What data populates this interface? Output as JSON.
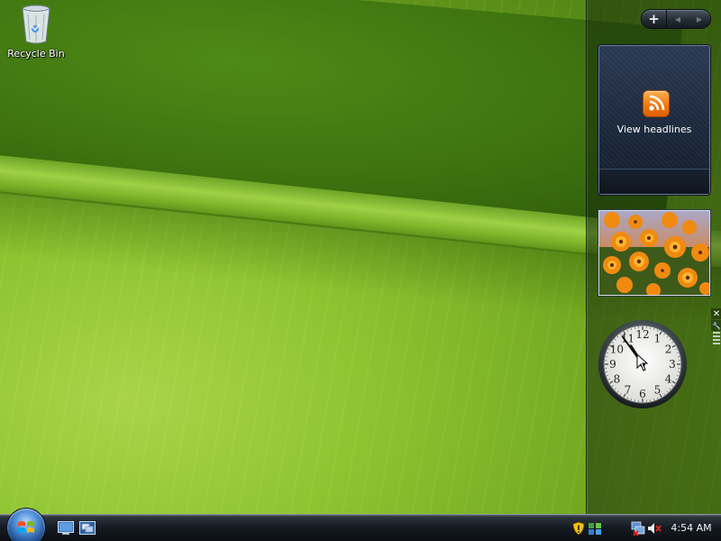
{
  "desktop": {
    "icons": [
      {
        "label": "Recycle Bin",
        "icon": "recycle-bin-icon"
      }
    ]
  },
  "sidebar": {
    "controls": {
      "add_label": "+",
      "prev_label": "◀",
      "next_label": "▶"
    },
    "feed_gadget": {
      "icon": "rss-icon",
      "link_text": "View headlines"
    },
    "slideshow_gadget": {
      "subject": "orange-flowers-photo"
    },
    "clock_gadget": {
      "numerals": [
        "12",
        "1",
        "2",
        "3",
        "4",
        "5",
        "6",
        "7",
        "8",
        "9",
        "10",
        "11"
      ],
      "hour_hand_time": 10.9,
      "minute_hand_minutes": 54,
      "close_label": "✕",
      "options_label": "🔧"
    }
  },
  "taskbar": {
    "start_icon": "windows-orb-icon",
    "quick_launch": [
      {
        "icon": "show-desktop-icon"
      },
      {
        "icon": "switch-windows-icon"
      }
    ],
    "tray_icons": [
      "security-shield-icon",
      "windows-update-icon",
      "network-disconnected-icon",
      "volume-muted-icon"
    ],
    "clock": "4:54 AM"
  },
  "colors": {
    "wallpaper_green": "#8fc431",
    "sidebar_dark": "#1a263a",
    "rss_orange": "#f27a12",
    "taskbar_dark": "#141a20"
  }
}
